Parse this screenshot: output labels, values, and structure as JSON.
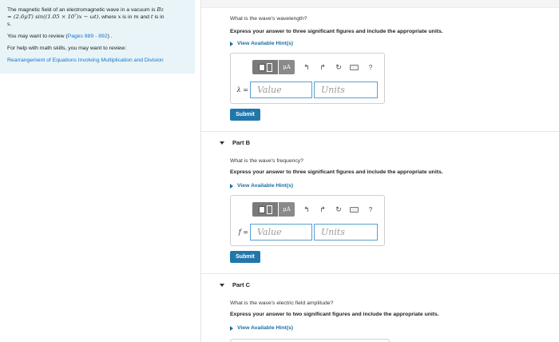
{
  "problem": {
    "intro_prefix": "The magnetic field of an electromagnetic wave in a vacuum is ",
    "field_symbol": "Bz",
    "equation": "= (2.6μT) sin((1.05 × 10⁷)x − ωt)",
    "intro_suffix_1": ", where ",
    "var_x": "x",
    "intro_suffix_2": " is in ",
    "unit_m": "m",
    "intro_suffix_3": " and ",
    "var_t": "t",
    "intro_suffix_4": " is in ",
    "unit_s": "s",
    "intro_suffix_5": ".",
    "review_prefix": "You may want to review (",
    "review_pages": "Pages 889 - 892",
    "review_suffix": ") .",
    "help_text": "For help with math skills, you may want to review:",
    "help_link": "Rearrangement of Equations Involving Multiplication and Division"
  },
  "parts": {
    "a": {
      "question": "What is the wave's wavelength?",
      "instruction": "Express your answer to three significant figures and include the appropriate units.",
      "hint_label": "View Available Hint(s)",
      "variable": "λ =",
      "value_placeholder": "Value",
      "units_placeholder": "Units",
      "submit_label": "Submit"
    },
    "b": {
      "title": "Part B",
      "question": "What is the wave's frequency?",
      "instruction": "Express your answer to three significant figures and include the appropriate units.",
      "hint_label": "View Available Hint(s)",
      "variable": "f =",
      "value_placeholder": "Value",
      "units_placeholder": "Units",
      "submit_label": "Submit"
    },
    "c": {
      "title": "Part C",
      "question": "What is the wave's electric field amplitude?",
      "instruction": "Express your answer to two significant figures and include the appropriate units.",
      "hint_label": "View Available Hint(s)"
    }
  },
  "toolbar": {
    "mu_label": "μA",
    "undo_icon": "↰",
    "redo_icon": "↱",
    "reset_icon": "↻",
    "keyboard_icon": "keyboard-icon",
    "help_icon": "?"
  },
  "colors": {
    "panel_bg": "#e8f4f8",
    "link": "#1a73c7",
    "hint": "#1a6fa3",
    "submit": "#2277aa",
    "field_border": "#5a9fd0"
  }
}
